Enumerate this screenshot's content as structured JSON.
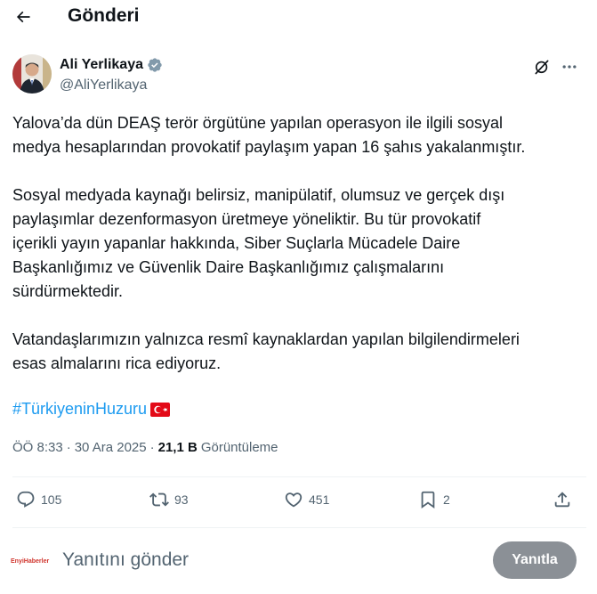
{
  "header": {
    "back_icon": "arrow-left-icon",
    "title": "Gönderi"
  },
  "author": {
    "name": "Ali Yerlikaya",
    "handle": "@AliYerlikaya",
    "verified_icon": "verified-badge-icon",
    "verified_color": "#829aab"
  },
  "post": {
    "paragraphs": [
      [
        "Yalova’da dün DEAŞ terör örgütüne yapılan operasyon ile ilgili sosyal",
        "medya hesaplarından provokatif paylaşım yapan 16 şahıs yakalanmıştır."
      ],
      [
        "Sosyal medyada kaynağı belirsiz, manipülatif, olumsuz ve gerçek dışı",
        "paylaşımlar dezenformasyon üretmeye yöneliktir. Bu tür provokatif",
        "içerikli yayın yapanlar hakkında, Siber Suçlarla Mücadele Daire",
        "Başkanlığımız ve Güvenlik Daire Başkanlığımız çalışmalarını",
        "sürdürmektedir."
      ],
      [
        "Vatandaşlarımızın yalnızca resmî kaynaklardan yapılan bilgilendirmeleri",
        "esas almalarını rica ediyoruz."
      ]
    ],
    "hashtag": "#TürkiyeninHuzuru",
    "flag_icon": "turkey-flag-icon",
    "time": "ÖÖ 8:33",
    "separator": "·",
    "date": "30 Ara 2025",
    "views_count": "21,1 B",
    "views_label": "Görüntüleme"
  },
  "actions": {
    "replies": "105",
    "reposts": "93",
    "likes": "451",
    "bookmarks": "2"
  },
  "reply": {
    "avatar_text": "EnyiHaberler",
    "placeholder": "Yanıtını gönder",
    "button_label": "Yanıtla"
  },
  "colors": {
    "accent": "#1d9bf0",
    "muted": "#536471",
    "text": "#0f1419",
    "button_disabled": "#8b9096"
  }
}
